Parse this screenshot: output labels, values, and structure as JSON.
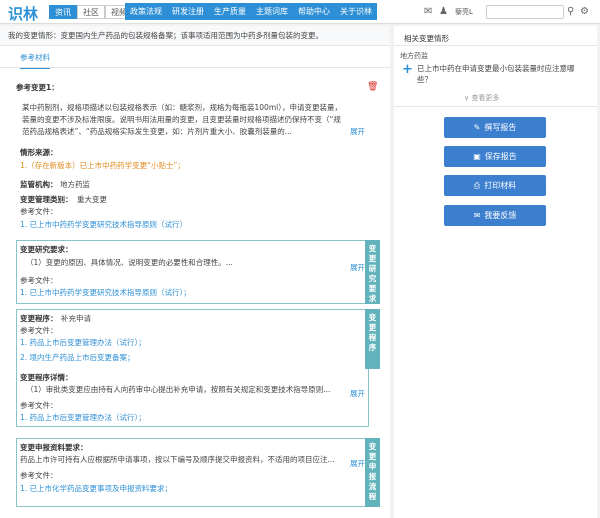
{
  "header": {
    "logo": "识林",
    "source_tabs": [
      "资讯",
      "社区",
      "视频"
    ],
    "nav": [
      "政策法规",
      "研发注册",
      "生产质量",
      "主题词库",
      "帮助中心",
      "关于识林"
    ],
    "user": "藜亮L"
  },
  "intro": "我的变更情形：变更国内生产药品的包装规格备案；该事项适用范围为中药多剂量包装的变更。",
  "tab_label": "参考材料",
  "ref1": {
    "title": "参考变更1：",
    "paragraph": "某中药制剂，规格项描述以包装规格表示（如：糖浆剂，规格为每瓶装100ml），申请变更装量，装量的变更不涉及标准限度。说明书用法用量的变更，且变更装量时规格项描述仍保持不变（“规范药品规格表述”、“药品规格实际发生变更，如：片剂片重大小、胶囊剂装量的...",
    "expand": "展开",
    "source_label": "情形来源：",
    "source_item": "1.（存在新版本）已上市中药药学变更“小贴士”；",
    "authority_label": "监管机构：",
    "authority_value": "地方药监",
    "mgmt_label": "变更管理类别：",
    "mgmt_value": "重大变更",
    "file_label": "参考文件：",
    "file1": "1. 已上市中药药学变更研究技术指导原则（试行）"
  },
  "research": {
    "side_label": "变更研究要求",
    "title": "变更研究要求：",
    "paragraph": "（1）变更的原因、具体情况、说明变更的必要性和合理性。...",
    "expand": "展开",
    "file_label": "参考文件：",
    "file1": "1. 已上市中药药学变更研究技术指导原则（试行）；"
  },
  "procedure": {
    "side_label": "变更程序",
    "title": "变更程序：",
    "value": "补充申请",
    "file_label": "参考文件：",
    "file1": "1. 药品上市后变更管理办法（试行）；",
    "file2": "2. 境内生产药品上市后变更备案；",
    "detail_title": "变更程序详情：",
    "detail_paragraph": "（1）审批类变更应由持有人向药审中心提出补充申请，按照有关规定和变更技术指导原则...",
    "detail_expand": "展开",
    "detail_file_label": "参考文件：",
    "detail_file1": "1. 药品上市后变更管理办法（试行）；"
  },
  "submission": {
    "side_label": "变更申报流程",
    "title": "变更申报资料要求：",
    "paragraph": "药品上市许可持有人应根据所申请事项，按以下编号及顺序提交申报资料，不适用的项目应注...",
    "expand": "展开",
    "file_label": "参考文件：",
    "file1": "1. 已上市化学药品变更事项及申报资料要求；"
  },
  "sidebar": {
    "title": "相关变更情形",
    "sub": "地方药监",
    "question": "已上市中药在申请变更最小包装装量时应注意哪些？",
    "more": "查看更多",
    "buttons": [
      "撰写报告",
      "保存报告",
      "打印材料",
      "我要反馈"
    ]
  },
  "colors": {
    "accent": "#2d8fd5",
    "teal": "#63b3bd",
    "button": "#3d7fcf",
    "orange": "#e08a1e",
    "danger": "#d9302a"
  }
}
